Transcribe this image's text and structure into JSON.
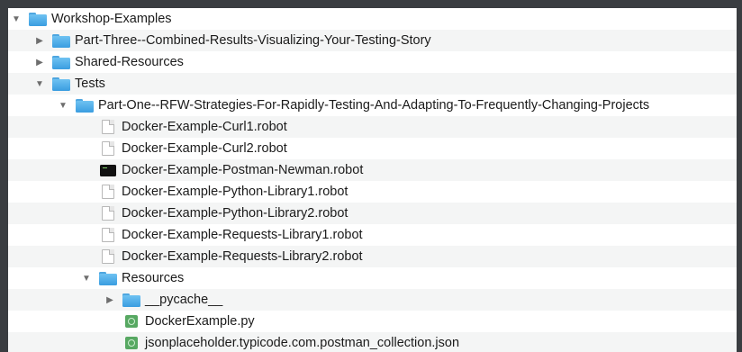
{
  "tree": [
    {
      "label": "Workshop-Examples",
      "kind": "folder",
      "expanded": true,
      "depth": 0
    },
    {
      "label": "Part-Three--Combined-Results-Visualizing-Your-Testing-Story",
      "kind": "folder",
      "expanded": false,
      "depth": 1
    },
    {
      "label": "Shared-Resources",
      "kind": "folder",
      "expanded": false,
      "depth": 1
    },
    {
      "label": "Tests",
      "kind": "folder",
      "expanded": true,
      "depth": 1
    },
    {
      "label": "Part-One--RFW-Strategies-For-Rapidly-Testing-And-Adapting-To-Frequently-Changing-Projects",
      "kind": "folder",
      "expanded": true,
      "depth": 2
    },
    {
      "label": "Docker-Example-Curl1.robot",
      "kind": "file",
      "depth": 3
    },
    {
      "label": "Docker-Example-Curl2.robot",
      "kind": "file",
      "depth": 3
    },
    {
      "label": "Docker-Example-Postman-Newman.robot",
      "kind": "terminal",
      "depth": 3
    },
    {
      "label": "Docker-Example-Python-Library1.robot",
      "kind": "file",
      "depth": 3
    },
    {
      "label": "Docker-Example-Python-Library2.robot",
      "kind": "file",
      "depth": 3
    },
    {
      "label": "Docker-Example-Requests-Library1.robot",
      "kind": "file",
      "depth": 3
    },
    {
      "label": "Docker-Example-Requests-Library2.robot",
      "kind": "file",
      "depth": 3
    },
    {
      "label": "Resources",
      "kind": "folder",
      "expanded": true,
      "depth": 3
    },
    {
      "label": "__pycache__",
      "kind": "folder",
      "expanded": false,
      "depth": 4
    },
    {
      "label": "DockerExample.py",
      "kind": "python",
      "depth": 4
    },
    {
      "label": "jsonplaceholder.typicode.com.postman_collection.json",
      "kind": "python",
      "depth": 4
    }
  ],
  "colors": {
    "background": "#3a3d41",
    "folder": "#4ea6e0",
    "disclosure": "#6e6e6e",
    "row_stripe": "#f4f5f5"
  },
  "icons": {
    "folder": "folder-icon",
    "file": "document-icon",
    "terminal": "terminal-icon",
    "python": "python-file-icon",
    "expanded": "triangle-down-icon",
    "collapsed": "triangle-right-icon"
  }
}
